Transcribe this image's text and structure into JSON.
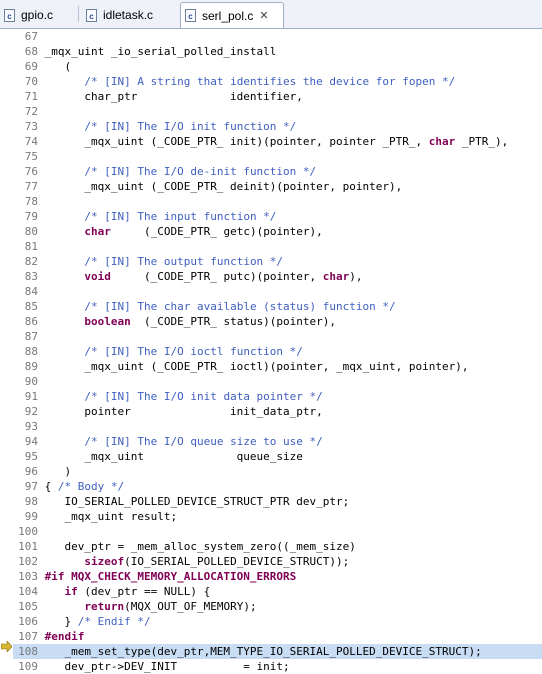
{
  "tabs": [
    {
      "label": "gpio.c",
      "active": false
    },
    {
      "label": "idletask.c",
      "active": false
    },
    {
      "label": "serl_pol.c",
      "active": true,
      "close": "✕"
    }
  ],
  "code_lines": [
    {
      "n": "67",
      "t": ""
    },
    {
      "n": "68",
      "t": "_mqx_uint _io_serial_polled_install"
    },
    {
      "n": "69",
      "t": "   ("
    },
    {
      "n": "70",
      "t": "      /* [IN] A string that identifies the device for fopen */"
    },
    {
      "n": "71",
      "t": "      char_ptr              identifier,"
    },
    {
      "n": "72",
      "t": ""
    },
    {
      "n": "73",
      "t": "      /* [IN] The I/O init function */"
    },
    {
      "n": "74",
      "t": "      _mqx_uint (_CODE_PTR_ init)(pointer, pointer _PTR_, char _PTR_),"
    },
    {
      "n": "75",
      "t": ""
    },
    {
      "n": "76",
      "t": "      /* [IN] The I/O de-init function */"
    },
    {
      "n": "77",
      "t": "      _mqx_uint (_CODE_PTR_ deinit)(pointer, pointer),"
    },
    {
      "n": "78",
      "t": ""
    },
    {
      "n": "79",
      "t": "      /* [IN] The input function */"
    },
    {
      "n": "80",
      "t": "      char     (_CODE_PTR_ getc)(pointer),"
    },
    {
      "n": "81",
      "t": ""
    },
    {
      "n": "82",
      "t": "      /* [IN] The output function */"
    },
    {
      "n": "83",
      "t": "      void     (_CODE_PTR_ putc)(pointer, char),"
    },
    {
      "n": "84",
      "t": ""
    },
    {
      "n": "85",
      "t": "      /* [IN] The char available (status) function */"
    },
    {
      "n": "86",
      "t": "      boolean  (_CODE_PTR_ status)(pointer),"
    },
    {
      "n": "87",
      "t": ""
    },
    {
      "n": "88",
      "t": "      /* [IN] The I/O ioctl function */"
    },
    {
      "n": "89",
      "t": "      _mqx_uint (_CODE_PTR_ ioctl)(pointer, _mqx_uint, pointer),"
    },
    {
      "n": "90",
      "t": ""
    },
    {
      "n": "91",
      "t": "      /* [IN] The I/O init data pointer */"
    },
    {
      "n": "92",
      "t": "      pointer               init_data_ptr,"
    },
    {
      "n": "93",
      "t": ""
    },
    {
      "n": "94",
      "t": "      /* [IN] The I/O queue size to use */"
    },
    {
      "n": "95",
      "t": "      _mqx_uint              queue_size"
    },
    {
      "n": "96",
      "t": "   )"
    },
    {
      "n": "97",
      "t": "{ /* Body */"
    },
    {
      "n": "98",
      "t": "   IO_SERIAL_POLLED_DEVICE_STRUCT_PTR dev_ptr;"
    },
    {
      "n": "99",
      "t": "   _mqx_uint result;"
    },
    {
      "n": "100",
      "t": ""
    },
    {
      "n": "101",
      "t": "   dev_ptr = _mem_alloc_system_zero((_mem_size)"
    },
    {
      "n": "102",
      "t": "      sizeof(IO_SERIAL_POLLED_DEVICE_STRUCT));"
    },
    {
      "n": "103",
      "t": "#if MQX_CHECK_MEMORY_ALLOCATION_ERRORS"
    },
    {
      "n": "104",
      "t": "   if (dev_ptr == NULL) {"
    },
    {
      "n": "105",
      "t": "      return(MQX_OUT_OF_MEMORY);"
    },
    {
      "n": "106",
      "t": "   } /* Endif */"
    },
    {
      "n": "107",
      "t": "#endif"
    },
    {
      "n": "108",
      "t": "   _mem_set_type(dev_ptr,MEM_TYPE_IO_SERIAL_POLLED_DEVICE_STRUCT);",
      "current": true
    },
    {
      "n": "109",
      "t": "   dev_ptr->DEV_INIT          = init;"
    }
  ],
  "colors": {
    "comment": "#3f5fbf",
    "keyword": "#7f0055",
    "current_line": "#c8dcf3"
  }
}
